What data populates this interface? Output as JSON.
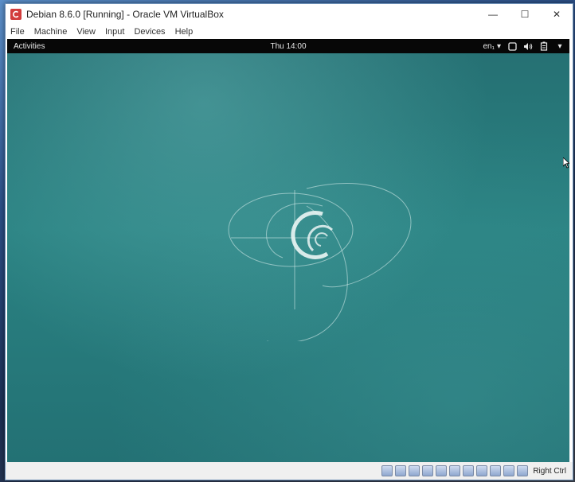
{
  "window": {
    "title": "Debian 8.6.0 [Running] - Oracle VM VirtualBox",
    "controls": {
      "minimize": "—",
      "maximize": "☐",
      "close": "✕"
    }
  },
  "menu": [
    "File",
    "Machine",
    "View",
    "Input",
    "Devices",
    "Help"
  ],
  "guest": {
    "activities": "Activities",
    "clock": "Thu 14:00",
    "language": "en₁",
    "tray": [
      "screen-icon",
      "volume-icon",
      "battery-icon",
      "dropdown-arrow-icon"
    ],
    "wallpaper_colors": {
      "dark": "#236e72",
      "light": "#4aa09c"
    }
  },
  "statusbar": {
    "icons": [
      "harddisk-icon",
      "optical-drive-icon",
      "audio-icon",
      "pencil-icon",
      "floppy-icon",
      "display-icon",
      "network-icon",
      "usb-icon",
      "shared-folders-icon",
      "recording-icon",
      "mouse-integration-icon"
    ],
    "host_key": "Right Ctrl"
  }
}
